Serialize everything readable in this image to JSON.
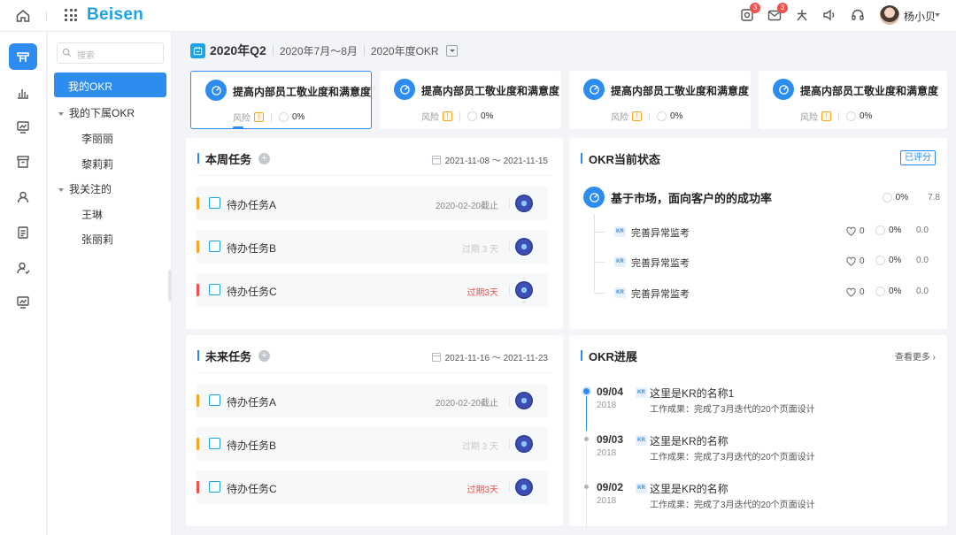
{
  "topbar": {
    "logo": "Beisen",
    "user_name": "杨小贝",
    "badges": {
      "notification": "3",
      "message": "3"
    }
  },
  "sidebar": {
    "search_placeholder": "搜索",
    "my_okr": "我的OKR",
    "subordinates": {
      "label": "我的下属OKR",
      "items": [
        "李丽丽",
        "黎莉莉"
      ]
    },
    "following": {
      "label": "我关注的",
      "items": [
        "王琳",
        "张丽莉"
      ]
    }
  },
  "period": {
    "quarter": "2020年Q2",
    "range": "2020年7月～8月",
    "annual": "2020年度OKR"
  },
  "okr_cards": [
    {
      "title": "提高内部员工敬业度和满意度",
      "risk_label": "风险",
      "risk_mark": "!",
      "progress": "0%"
    },
    {
      "title": "提高内部员工敬业度和满意度",
      "risk_label": "风险",
      "risk_mark": "!",
      "progress": "0%"
    },
    {
      "title": "提高内部员工敬业度和满意度",
      "risk_label": "风险",
      "risk_mark": "!",
      "progress": "0%"
    },
    {
      "title": "提高内部员工敬业度和满意度",
      "risk_label": "风险",
      "risk_mark": "!",
      "progress": "0%"
    }
  ],
  "this_week": {
    "title": "本周任务",
    "date_range": "2021-11-08 ～ 2021-11-15",
    "tasks": [
      {
        "name": "待办任务A",
        "due": "2020-02-20截止",
        "due_color": "#888888",
        "priority_color": "#f5a623"
      },
      {
        "name": "待办任务B",
        "due": "过期 3 天",
        "due_color": "#c8c8c8",
        "priority_color": "#f5a623"
      },
      {
        "name": "待办任务C",
        "due": "过期3天",
        "due_color": "#f0504b",
        "priority_color": "#f0504b"
      }
    ]
  },
  "future": {
    "title": "未来任务",
    "date_range": "2021-11-16 ～ 2021-11-23",
    "tasks": [
      {
        "name": "待办任务A",
        "due": "2020-02-20截止",
        "due_color": "#888888",
        "priority_color": "#f5a623"
      },
      {
        "name": "待办任务B",
        "due": "过期 3 天",
        "due_color": "#c8c8c8",
        "priority_color": "#f5a623"
      },
      {
        "name": "待办任务C",
        "due": "过期3天",
        "due_color": "#f0504b",
        "priority_color": "#f0504b"
      }
    ]
  },
  "okr_status": {
    "title": "OKR当前状态",
    "eval_tag": "已评分",
    "objective": {
      "title": "基于市场，面向客户的的成功率",
      "progress": "0%",
      "score": "7.8"
    },
    "krs": [
      {
        "badge": "KR",
        "name": "完善异常监考",
        "likes": "0",
        "progress": "0%",
        "score": "0.0"
      },
      {
        "badge": "KR",
        "name": "完善异常监考",
        "likes": "0",
        "progress": "0%",
        "score": "0.0"
      },
      {
        "badge": "KR",
        "name": "完善异常监考",
        "likes": "0",
        "progress": "0%",
        "score": "0.0"
      }
    ]
  },
  "okr_progress": {
    "title": "OKR进展",
    "more": "查看更多",
    "items": [
      {
        "date": "09/04",
        "year": "2018",
        "badge": "KR",
        "kr_name": "这里是KR的名称1",
        "result": "工作成果：完成了3月迭代的20个页面设计"
      },
      {
        "date": "09/03",
        "year": "2018",
        "badge": "KR",
        "kr_name": "这里是KR的名称",
        "result": "工作成果：完成了3月迭代的20个页面设计"
      },
      {
        "date": "09/02",
        "year": "2018",
        "badge": "KR",
        "kr_name": "这里是KR的名称",
        "result": "工作成果：完成了3月迭代的20个页面设计"
      }
    ]
  },
  "colors": {
    "accent": "#2d8cf0",
    "brand": "#1aa3e8",
    "warning": "#f5a623",
    "danger": "#f0504b"
  }
}
